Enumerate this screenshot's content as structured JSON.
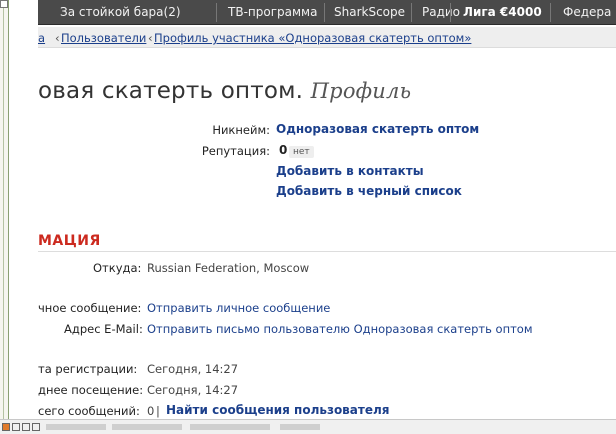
{
  "nav": {
    "items": [
      "За стойкой бара(2)",
      "ТВ-программа",
      "SharkScope",
      "Радио",
      "Лига €4000",
      "Федера"
    ]
  },
  "breadcrumb": {
    "items": [
      "а",
      "Пользователи",
      "Профиль участника «Одноразовая скатерть оптом»"
    ],
    "arrow": "‹"
  },
  "title": {
    "main": "овая скатерть оптом.",
    "suffix": "Профиль"
  },
  "profile": {
    "nickname_label": "Никнейм:",
    "nickname_value": "Одноразовая скатерть оптом",
    "reputation_label": "Репутация:",
    "reputation_value": "0",
    "reputation_badge": "нет",
    "add_contacts": "Добавить в контакты",
    "add_blacklist": "Добавить в черный список"
  },
  "section": {
    "header": "МАЦИЯ"
  },
  "info": {
    "from_label": "Откуда:",
    "from_value": "Russian Federation, Moscow",
    "pm_label": "чное сообщение:",
    "pm_link": "Отправить личное сообщение",
    "email_label": "Адрес E-Mail:",
    "email_link": "Отправить письмо пользователю Одноразовая скатерть оптом",
    "reg_label": "та регистрации:",
    "reg_value": "Сегодня, 14:27",
    "last_label": "днее посещение:",
    "last_value": "Сегодня, 14:27",
    "posts_label": "сего сообщений:",
    "posts_count": "0",
    "posts_sep": "|",
    "posts_link": "Найти сообщения пользователя"
  }
}
